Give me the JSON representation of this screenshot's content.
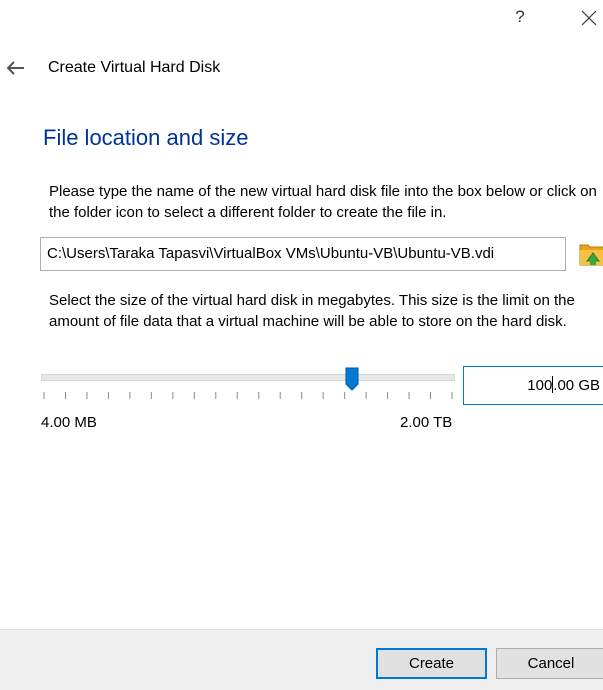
{
  "titlebar": {
    "help_label": "?",
    "close_icon": "close-icon"
  },
  "header": {
    "back_icon": "arrow-left-icon",
    "title": "Create Virtual Hard Disk"
  },
  "section": {
    "heading": "File location and size",
    "location_instructions": "Please type the name of the new virtual hard disk file into the box below or click on the folder icon to select a different folder to create the file in.",
    "file_path": "C:\\Users\\Taraka Tapasvi\\VirtualBox VMs\\Ubuntu-VB\\Ubuntu-VB.vdi",
    "folder_icon": "folder-icon",
    "size_instructions": "Select the size of the virtual hard disk in megabytes. This size is the limit on the amount of file data that a virtual machine will be able to store on the hard disk."
  },
  "size": {
    "slider_min_label": "4.00 MB",
    "slider_max_label": "2.00 TB",
    "slider_level": 0.75,
    "tick_count": 20,
    "value_before_caret": "100",
    "value_after_caret": ".00 GB"
  },
  "footer": {
    "create_label": "Create",
    "cancel_label": "Cancel"
  },
  "colors": {
    "heading": "#003399",
    "accent": "#0078d7",
    "footer_bg": "#f0f0f0"
  }
}
